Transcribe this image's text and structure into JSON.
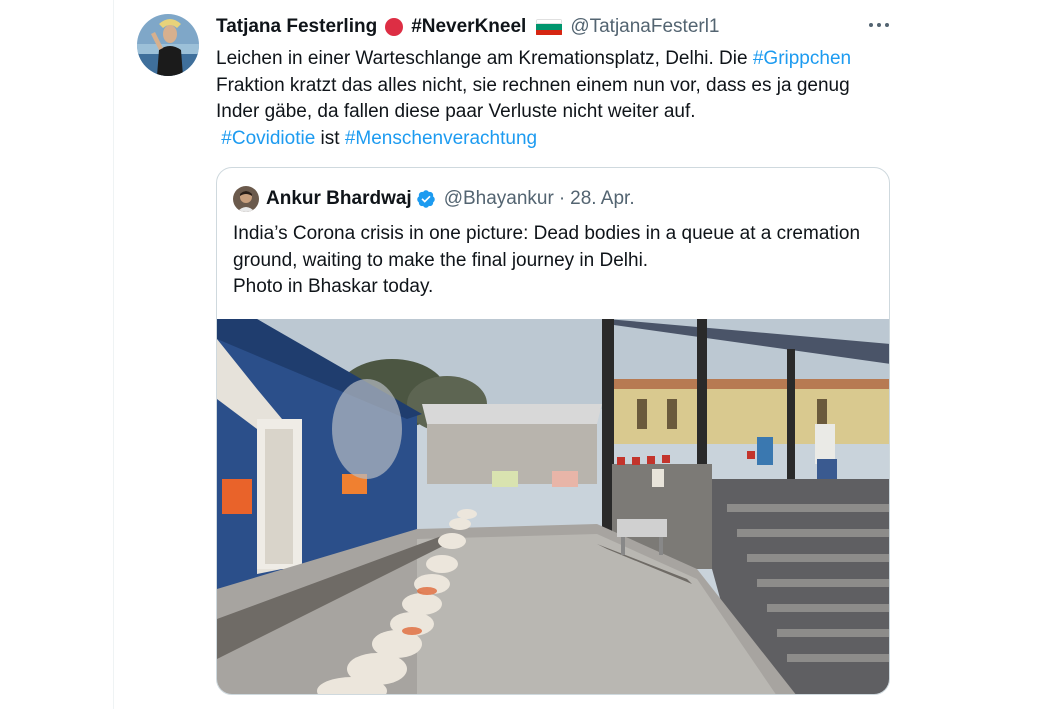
{
  "tweet": {
    "author": {
      "display_name": "Tatjana Festerling",
      "tag": "#NeverKneel",
      "handle": "@TatjanaFesterl1"
    },
    "text": {
      "line1_a": "Leichen in einer Warteschlange am Kremationsplatz, Delhi. Die ",
      "line1_hashtag": "#Grippchen",
      "line2": " Fraktion kratzt das alles nicht, sie rechnen einem nun vor, dass es ja genug Inder gäbe, da fallen diese paar Verluste nicht weiter auf.",
      "hashtag2": "#Covidiotie",
      "mid": " ist ",
      "hashtag3": "#Menschenverachtung"
    },
    "icons": {
      "more": "more-icon",
      "red_circle": "red-circle-emoji",
      "flag": "bulgaria-flag-emoji"
    }
  },
  "quoted": {
    "author": {
      "display_name": "Ankur Bhardwaj",
      "handle": "@Bhayankur",
      "separator": "·",
      "date": "28. Apr."
    },
    "text": {
      "line1": "India’s Corona crisis in one picture: Dead bodies in a queue at a cremation ground, waiting to make the final journey in Delhi.",
      "line2": "Photo in Bhaskar today."
    },
    "icons": {
      "verified": "verified-badge-icon"
    },
    "photo": {
      "subject": "cremation-ground-photo"
    }
  },
  "colors": {
    "link": "#1d9bf0",
    "secondary": "#536471",
    "border": "#cfd9de",
    "primary": "#0f1419"
  }
}
